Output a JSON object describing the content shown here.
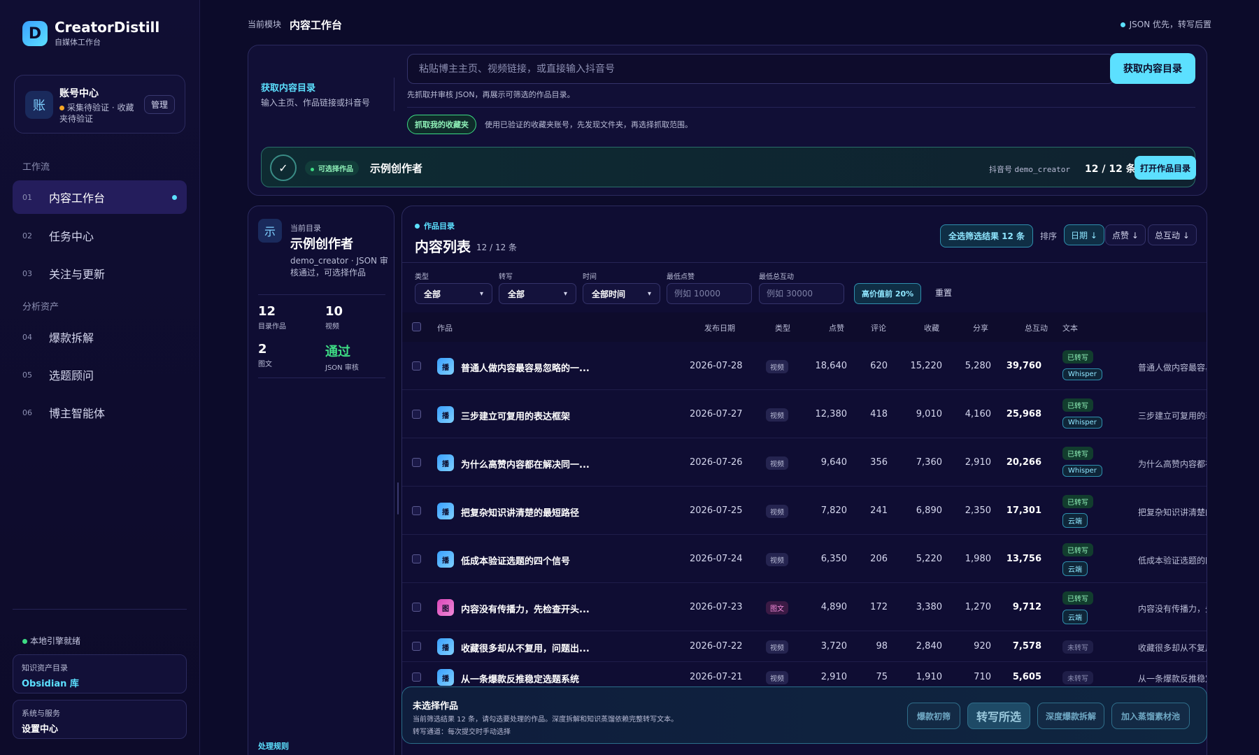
{
  "brand": {
    "name": "CreatorDistill",
    "subtitle": "自媒体工作台",
    "logo_letter": "D"
  },
  "account": {
    "avatar": "账",
    "title": "账号中心",
    "status": "采集待验证 · 收藏夹待验证",
    "manage": "管理"
  },
  "nav": {
    "group1": "工作流",
    "group2": "分析资产",
    "items": [
      {
        "num": "01",
        "label": "内容工作台"
      },
      {
        "num": "02",
        "label": "任务中心"
      },
      {
        "num": "03",
        "label": "关注与更新"
      },
      {
        "num": "04",
        "label": "爆款拆解"
      },
      {
        "num": "05",
        "label": "选题顾问"
      },
      {
        "num": "06",
        "label": "博主智能体"
      }
    ]
  },
  "sidebar_footer": {
    "engine": "本地引擎就绪",
    "knowledge_title": "知识资产目录",
    "knowledge_value": "Obsidian 库",
    "system_title": "系统与服务",
    "system_value": "设置中心"
  },
  "topbar": {
    "crumb": "当前模块",
    "title": "内容工作台",
    "right": "JSON 优先，转写后置"
  },
  "fetch": {
    "label_title": "获取内容目录",
    "label_sub": "输入主页、作品链接或抖音号",
    "input_placeholder": "粘贴博主主页、视频链接，或直接输入抖音号",
    "button": "获取内容目录",
    "hint": "先抓取并审核 JSON，再展示可筛选的作品目录。",
    "fav_pill": "抓取我的收藏夹",
    "fav_hint": "使用已验证的收藏夹账号，先发现文件夹，再选择抓取范围。"
  },
  "creator_bar": {
    "check": "✓",
    "pill": "可选择作品",
    "name": "示例创作者",
    "id_label": "抖音号",
    "id_value": "demo_creator",
    "count": "12 / 12 条",
    "open_btn": "打开作品目录"
  },
  "directory": {
    "avatar": "示",
    "kicker": "当前目录",
    "name": "示例创作者",
    "meta": "demo_creator · JSON 审核通过，可选择作品",
    "stats": [
      {
        "value": "12",
        "label": "目录作品"
      },
      {
        "value": "10",
        "label": "视频"
      },
      {
        "value": "2",
        "label": "图文"
      },
      {
        "value": "通过",
        "label": "JSON 审核"
      }
    ],
    "rules": "处理规则"
  },
  "list": {
    "kicker": "作品目录",
    "title": "内容列表",
    "count": "12 / 12 条",
    "select_all": "全选筛选结果 12 条",
    "sort_label": "排序",
    "sort": [
      "日期 ↓",
      "点赞 ↓",
      "总互动 ↓"
    ],
    "filters": {
      "type_label": "类型",
      "type_value": "全部",
      "tr_label": "转写",
      "tr_value": "全部",
      "time_label": "时间",
      "time_value": "全部时间",
      "likes_label": "最低点赞",
      "likes_placeholder": "例如 10000",
      "inter_label": "最低总互动",
      "inter_placeholder": "例如 30000",
      "top20": "高价值前 20%",
      "reset": "重置"
    },
    "headers": [
      "作品",
      "发布日期",
      "类型",
      "点赞",
      "评论",
      "收藏",
      "分享",
      "总互动",
      "文本"
    ],
    "rows": [
      {
        "icon": "播",
        "title": "普通人做内容最容易忽略的一...",
        "date": "2026-07-28",
        "type": "视频",
        "likes": "18,640",
        "comments": "620",
        "favs": "15,220",
        "shares": "5,280",
        "total": "39,760",
        "tr": "已转写",
        "src": "Whisper",
        "text": "普通人做内容最容易忽略"
      },
      {
        "icon": "播",
        "title": "三步建立可复用的表达框架",
        "date": "2026-07-27",
        "type": "视频",
        "likes": "12,380",
        "comments": "418",
        "favs": "9,010",
        "shares": "4,160",
        "total": "25,968",
        "tr": "已转写",
        "src": "Whisper",
        "text": "三步建立可复用的表达框架"
      },
      {
        "icon": "播",
        "title": "为什么高赞内容都在解决同一...",
        "date": "2026-07-26",
        "type": "视频",
        "likes": "9,640",
        "comments": "356",
        "favs": "7,360",
        "shares": "2,910",
        "total": "20,266",
        "tr": "已转写",
        "src": "Whisper",
        "text": "为什么高赞内容都在解决"
      },
      {
        "icon": "播",
        "title": "把复杂知识讲清楚的最短路径",
        "date": "2026-07-25",
        "type": "视频",
        "likes": "7,820",
        "comments": "241",
        "favs": "6,890",
        "shares": "2,350",
        "total": "17,301",
        "tr": "已转写",
        "src": "云端",
        "text": "把复杂知识讲清楚的最短"
      },
      {
        "icon": "播",
        "title": "低成本验证选题的四个信号",
        "date": "2026-07-24",
        "type": "视频",
        "likes": "6,350",
        "comments": "206",
        "favs": "5,220",
        "shares": "1,980",
        "total": "13,756",
        "tr": "已转写",
        "src": "云端",
        "text": "低成本验证选题的四个信号"
      },
      {
        "icon": "图",
        "title": "内容没有传播力，先检查开头...",
        "date": "2026-07-23",
        "type": "图文",
        "likes": "4,890",
        "comments": "172",
        "favs": "3,380",
        "shares": "1,270",
        "total": "9,712",
        "tr": "已转写",
        "src": "云端",
        "text": "内容没有传播力，先检查"
      },
      {
        "icon": "播",
        "title": "收藏很多却从不复用，问题出...",
        "date": "2026-07-22",
        "type": "视频",
        "likes": "3,720",
        "comments": "98",
        "favs": "2,840",
        "shares": "920",
        "total": "7,578",
        "tr": "未转写",
        "src": "",
        "text": "收藏很多却从不复用"
      },
      {
        "icon": "播",
        "title": "从一条爆款反推稳定选题系统",
        "date": "2026-07-21",
        "type": "视频",
        "likes": "2,910",
        "comments": "75",
        "favs": "1,910",
        "shares": "710",
        "total": "5,605",
        "tr": "未转写",
        "src": "",
        "text": "从一条爆款反推稳定选题"
      }
    ]
  },
  "action_bar": {
    "title": "未选择作品",
    "desc": "当前筛选结果 12 条，请勾选要处理的作品。深度拆解和知识蒸馏依赖完整转写文本。",
    "channel": "转写通道：每次提交时手动选择",
    "buttons": [
      "爆款初筛",
      "转写所选",
      "深度爆款拆解",
      "加入蒸馏素材池"
    ]
  },
  "colors": {
    "accent": "#5ce0ff",
    "success": "#3ddc84",
    "warning": "#f5a524",
    "background": "#0c0b2a"
  }
}
